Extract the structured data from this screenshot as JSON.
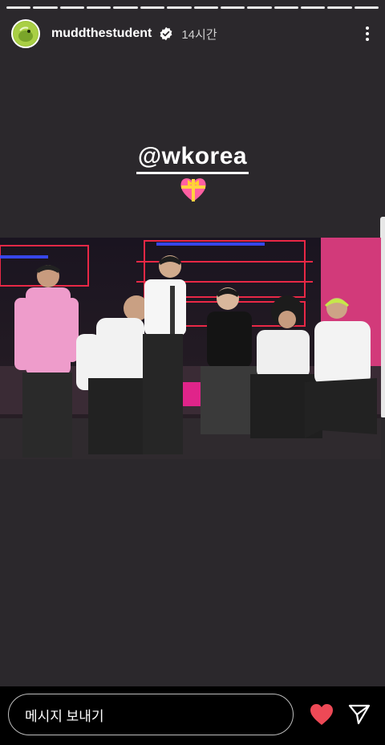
{
  "header": {
    "username": "muddthestudent",
    "time": "14시간",
    "segments": 14
  },
  "sticker": {
    "mention": "@wkorea"
  },
  "footer": {
    "message_placeholder": "메시지 보내기"
  },
  "icons": {
    "verified": "verified-badge-icon",
    "more": "more-vertical-icon",
    "heart_gift": "heart-with-ribbon-emoji",
    "like": "heart-icon",
    "send": "paper-plane-icon"
  },
  "colors": {
    "story_bg": "#2b282c",
    "like_red": "#ed4956",
    "avatar_green": "#9cc33a"
  }
}
